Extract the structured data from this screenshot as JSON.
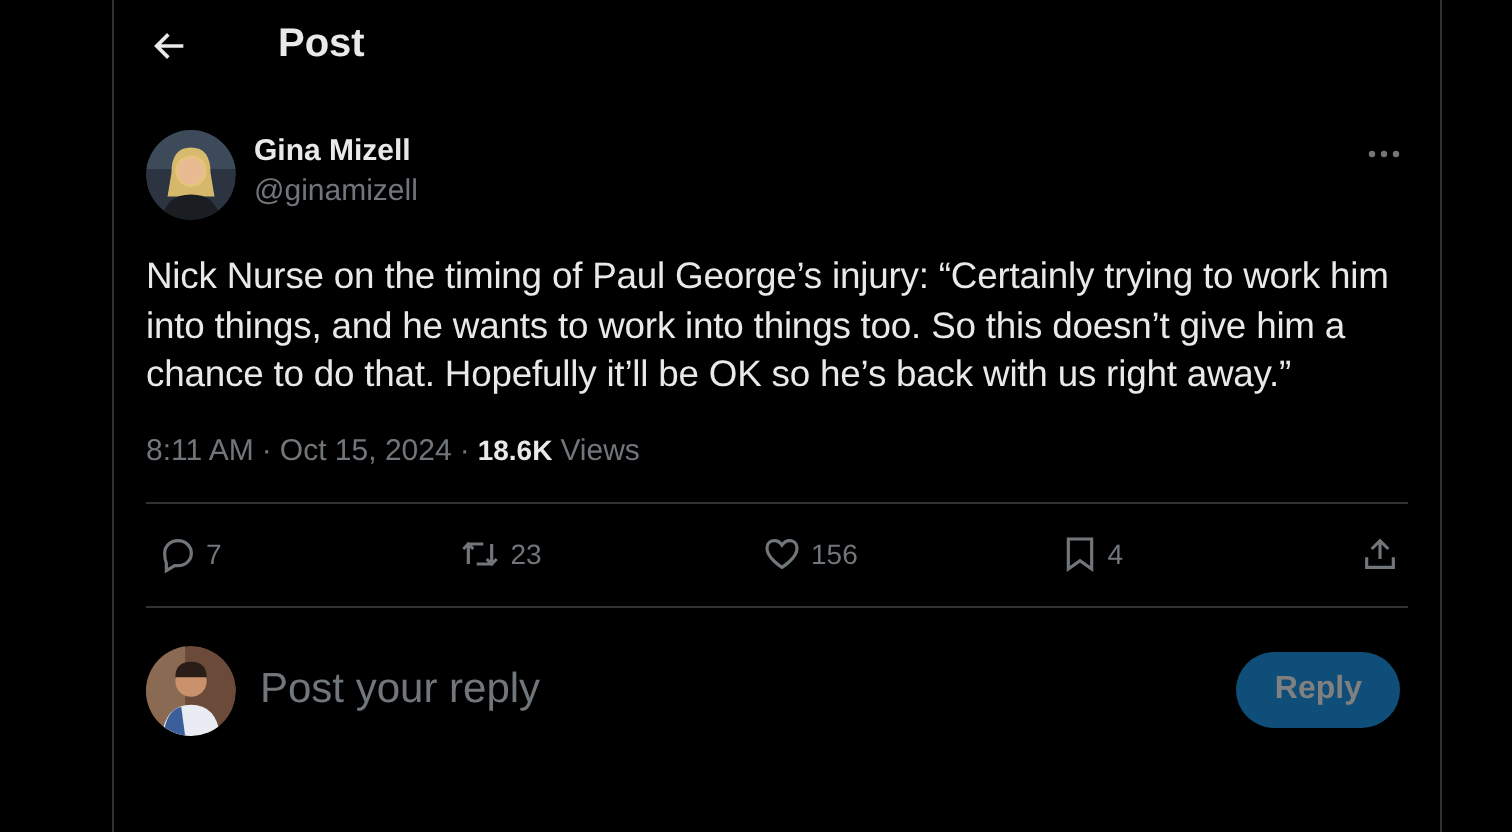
{
  "header": {
    "title": "Post"
  },
  "author": {
    "name": "Gina Mizell",
    "handle": "@ginamizell"
  },
  "post": {
    "text": "Nick Nurse on the timing of Paul George’s injury: “Certainly trying to work him into things, and he wants to work into things too. So this doesn’t give him a chance to do that. Hopefully it’ll be OK so he’s back with us right away.”",
    "time": "8:11 AM",
    "separator": "·",
    "date": "Oct 15, 2024",
    "views_count": "18.6K",
    "views_label": "Views"
  },
  "actions": [
    {
      "kind": "reply",
      "count": "7"
    },
    {
      "kind": "repost",
      "count": "23"
    },
    {
      "kind": "like",
      "count": "156"
    },
    {
      "kind": "bookmark",
      "count": "4"
    },
    {
      "kind": "share"
    }
  ],
  "composer": {
    "placeholder": "Post your reply",
    "button": {
      "label": "Reply",
      "disabled": true
    }
  }
}
